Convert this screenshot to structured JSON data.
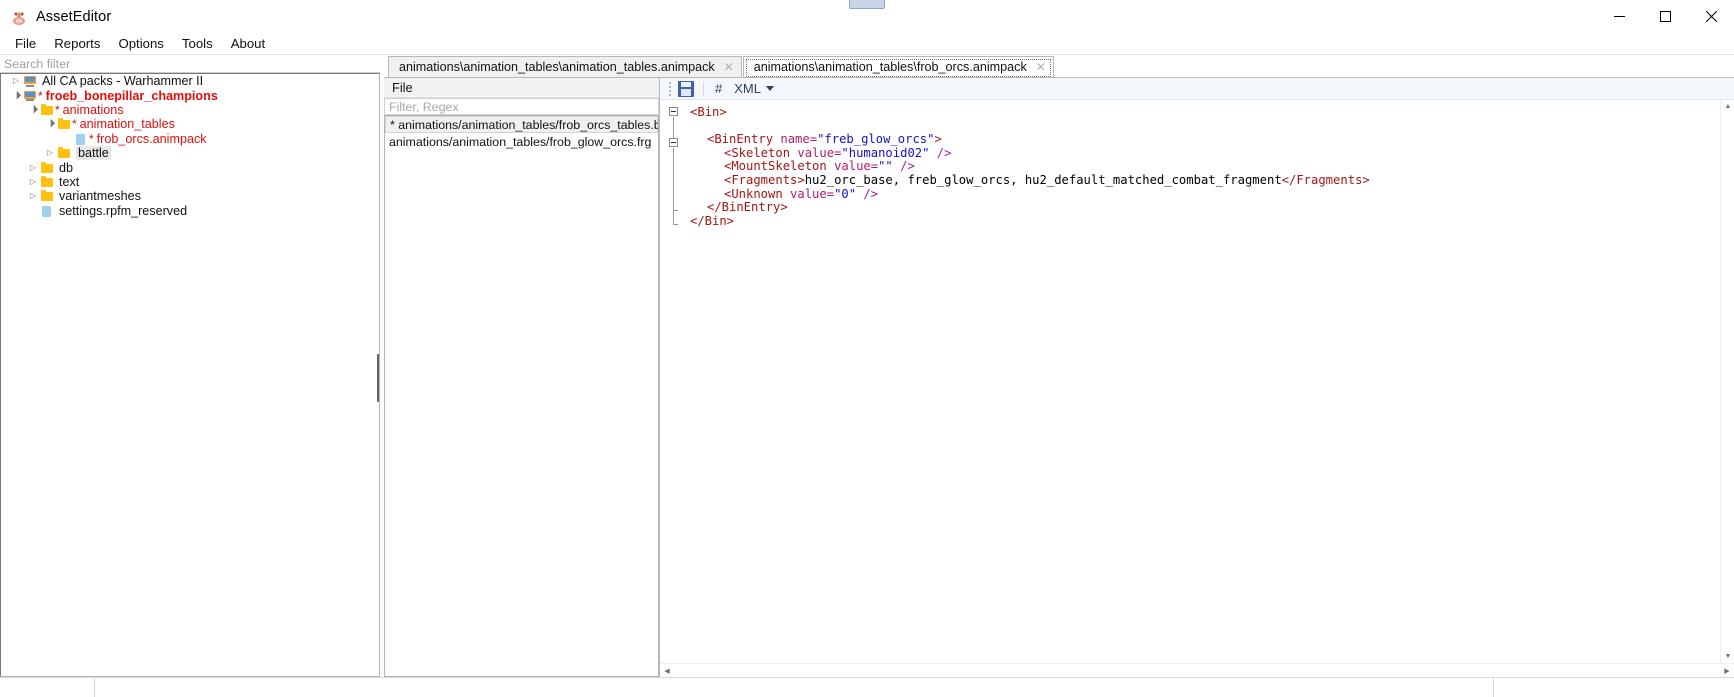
{
  "window": {
    "title": "AssetEditor",
    "app_icon": "app-icon",
    "minimize": "─",
    "maximize": "☐",
    "close": "✕"
  },
  "menubar": {
    "items": [
      {
        "label": "File"
      },
      {
        "label": "Reports"
      },
      {
        "label": "Options"
      },
      {
        "label": "Tools"
      },
      {
        "label": "About"
      }
    ]
  },
  "sidebar": {
    "search_placeholder": "Search filter",
    "tree": [
      {
        "label": "All CA packs - Warhammer II",
        "indent": 0,
        "arrow": "closed",
        "icon": "monitor-icon",
        "modified": false,
        "bold": false,
        "star": false
      },
      {
        "label": "froeb_bonepillar_champions",
        "indent": 0,
        "arrow": "open",
        "icon": "monitor-icon",
        "modified": true,
        "bold": true,
        "star": true
      },
      {
        "label": "animations",
        "indent": 1,
        "arrow": "open",
        "icon": "folder-icon",
        "modified": true,
        "bold": false,
        "star": true
      },
      {
        "label": "animation_tables",
        "indent": 2,
        "arrow": "open",
        "icon": "folder-icon",
        "modified": true,
        "bold": false,
        "star": true
      },
      {
        "label": "frob_orcs.animpack",
        "indent": 3,
        "arrow": "none",
        "icon": "file-icon",
        "modified": true,
        "bold": false,
        "star": true
      },
      {
        "label": "battle",
        "indent": 2,
        "arrow": "closed",
        "icon": "folder-icon",
        "modified": false,
        "bold": false,
        "star": false,
        "highlight": true
      },
      {
        "label": "db",
        "indent": 1,
        "arrow": "closed",
        "icon": "folder-icon",
        "modified": false,
        "bold": false,
        "star": false
      },
      {
        "label": "text",
        "indent": 1,
        "arrow": "closed",
        "icon": "folder-icon",
        "modified": false,
        "bold": false,
        "star": false
      },
      {
        "label": "variantmeshes",
        "indent": 1,
        "arrow": "closed",
        "icon": "folder-icon",
        "modified": false,
        "bold": false,
        "star": false
      },
      {
        "label": "settings.rpfm_reserved",
        "indent": 1,
        "arrow": "none",
        "icon": "file-icon",
        "modified": false,
        "bold": false,
        "star": false
      }
    ]
  },
  "tabs": [
    {
      "label": "animations\\animation_tables\\animation_tables.animpack",
      "active": false,
      "close": "✕"
    },
    {
      "label": "animations\\animation_tables\\frob_orcs.animpack",
      "active": true,
      "close": "✕"
    }
  ],
  "filelist": {
    "menu_label": "File",
    "filter_placeholder": "Filter, Regex",
    "rows": [
      {
        "label": "* animations/animation_tables/frob_orcs_tables.bin",
        "selected": true
      },
      {
        "label": "animations/animation_tables/frob_glow_orcs.frg",
        "selected": false
      }
    ]
  },
  "editor_toolbar": {
    "save_icon": "save-icon",
    "hash_icon": "#",
    "language": "XML",
    "caret_icon": "chevron-down-icon"
  },
  "code": {
    "language": "XML",
    "lines": [
      {
        "indent": 0,
        "fold": true,
        "parts": [
          {
            "t": "tag",
            "s": "<Bin>"
          }
        ]
      },
      {
        "indent": 0,
        "fold": false,
        "parts": []
      },
      {
        "indent": 1,
        "fold": true,
        "parts": [
          {
            "t": "tag",
            "s": "<BinEntry "
          },
          {
            "t": "attr",
            "s": "name="
          },
          {
            "t": "val",
            "s": "\"freb_glow_orcs\""
          },
          {
            "t": "tag",
            "s": ">"
          }
        ]
      },
      {
        "indent": 2,
        "fold": false,
        "parts": [
          {
            "t": "tag",
            "s": "<Skeleton "
          },
          {
            "t": "attr",
            "s": "value="
          },
          {
            "t": "val",
            "s": "\"humanoid02\""
          },
          {
            "t": "punc",
            "s": " />"
          }
        ]
      },
      {
        "indent": 2,
        "fold": false,
        "parts": [
          {
            "t": "tag",
            "s": "<MountSkeleton "
          },
          {
            "t": "attr",
            "s": "value="
          },
          {
            "t": "val",
            "s": "\"\""
          },
          {
            "t": "punc",
            "s": " />"
          }
        ]
      },
      {
        "indent": 2,
        "fold": false,
        "parts": [
          {
            "t": "tag",
            "s": "<Fragments>"
          },
          {
            "t": "txt",
            "s": "hu2_orc_base, freb_glow_orcs, hu2_default_matched_combat_fragment"
          },
          {
            "t": "tag",
            "s": "</Fragments>"
          }
        ]
      },
      {
        "indent": 2,
        "fold": false,
        "parts": [
          {
            "t": "tag",
            "s": "<Unknown "
          },
          {
            "t": "attr",
            "s": "value="
          },
          {
            "t": "val",
            "s": "\"0\""
          },
          {
            "t": "punc",
            "s": " />"
          }
        ]
      },
      {
        "indent": 1,
        "fold": false,
        "parts": [
          {
            "t": "tag",
            "s": "</BinEntry>"
          }
        ]
      },
      {
        "indent": 0,
        "fold": false,
        "parts": [
          {
            "t": "tag",
            "s": "</Bin>"
          }
        ]
      }
    ]
  },
  "scrollbars": {
    "up_arrow": "▲",
    "down_arrow": "▼",
    "left_arrow": "◀",
    "right_arrow": "▶"
  },
  "statusbar": {
    "cell1": "",
    "cell2": "",
    "cell3": ""
  },
  "colors": {
    "modified_red": "#e10e0e",
    "tag_red": "#a31515",
    "attr_pink": "#b31b6e",
    "value_blue": "#1111cc",
    "folder_yellow": "#ffc10e",
    "toolbar_bg": "#f4f7fb"
  }
}
